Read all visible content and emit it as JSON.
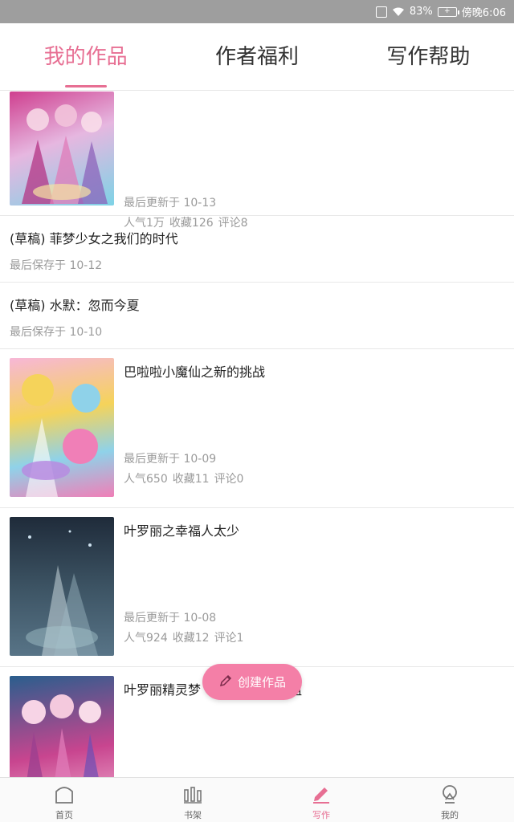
{
  "status_bar": {
    "battery": "83%",
    "time": "傍晚6:06"
  },
  "tabs": [
    {
      "label": "我的作品",
      "active": true
    },
    {
      "label": "作者福利",
      "active": false
    },
    {
      "label": "写作帮助",
      "active": false
    }
  ],
  "works": [
    {
      "type": "published",
      "title": "",
      "updated": "最后更新于 10-13",
      "popularity": "人气1万",
      "favorites": "收藏126",
      "comments": "评论8",
      "cover_colors": [
        "#cf3f8f",
        "#7dd3e6",
        "#e6b7e0"
      ]
    },
    {
      "type": "draft",
      "title": "(草稿) 菲梦少女之我们的时代",
      "saved": "最后保存于 10-12"
    },
    {
      "type": "draft",
      "title": "(草稿) 水默：忽而今夏",
      "saved": "最后保存于 10-10"
    },
    {
      "type": "published",
      "title": "巴啦啦小魔仙之新的挑战",
      "updated": "最后更新于 10-09",
      "popularity": "人气650",
      "favorites": "收藏11",
      "comments": "评论0",
      "cover_colors": [
        "#f7b7d7",
        "#f5d35a",
        "#8fd2e9"
      ]
    },
    {
      "type": "published",
      "title": "叶罗丽之幸福人太少",
      "updated": "最后更新于 10-08",
      "popularity": "人气924",
      "favorites": "收藏12",
      "comments": "评论1",
      "cover_colors": [
        "#1f2b3a",
        "#587487",
        "#c9d7dd"
      ]
    },
    {
      "type": "published",
      "title": "叶罗丽精灵梦",
      "title_tail": "组",
      "cover_colors": [
        "#2a5e8d",
        "#c8458f",
        "#f3b6d4"
      ]
    }
  ],
  "fab": {
    "label": "创建作品",
    "icon": "pencil-icon"
  },
  "bottom_nav": [
    {
      "label": "首页",
      "icon": "home-icon",
      "active": false
    },
    {
      "label": "书架",
      "icon": "bookshelf-icon",
      "active": false
    },
    {
      "label": "写作",
      "icon": "pencil-icon",
      "active": true
    },
    {
      "label": "我的",
      "icon": "profile-icon",
      "active": false
    }
  ],
  "colors": {
    "accent": "#e76f93",
    "fab": "#f47fa7",
    "status_bar": "#9e9e9e"
  }
}
